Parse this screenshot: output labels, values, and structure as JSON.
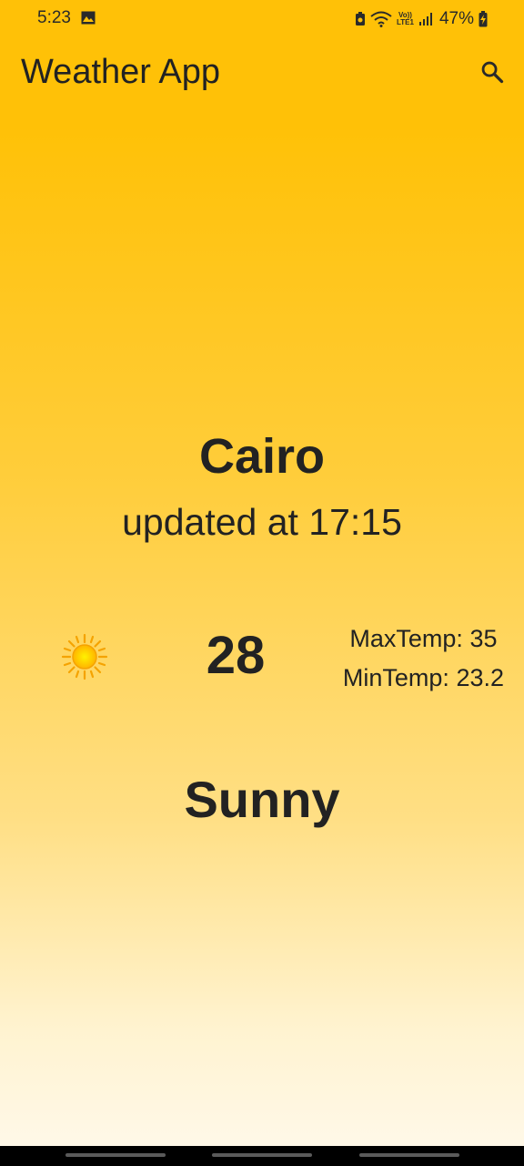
{
  "status_bar": {
    "time": "5:23",
    "battery": "47%",
    "volte_top": "Vo))",
    "volte_bottom": "LTE1"
  },
  "app_bar": {
    "title": "Weather App",
    "search_icon": "search-icon"
  },
  "weather": {
    "city": "Cairo",
    "updated": "updated at 17:15",
    "temp": "28",
    "max_temp": "MaxTemp: 35",
    "min_temp": "MinTemp: 23.2",
    "condition": "Sunny",
    "condition_icon": "sun-icon"
  },
  "colors": {
    "accent": "#ffc107",
    "background_bottom": "#fff8e8",
    "text": "#222222"
  }
}
